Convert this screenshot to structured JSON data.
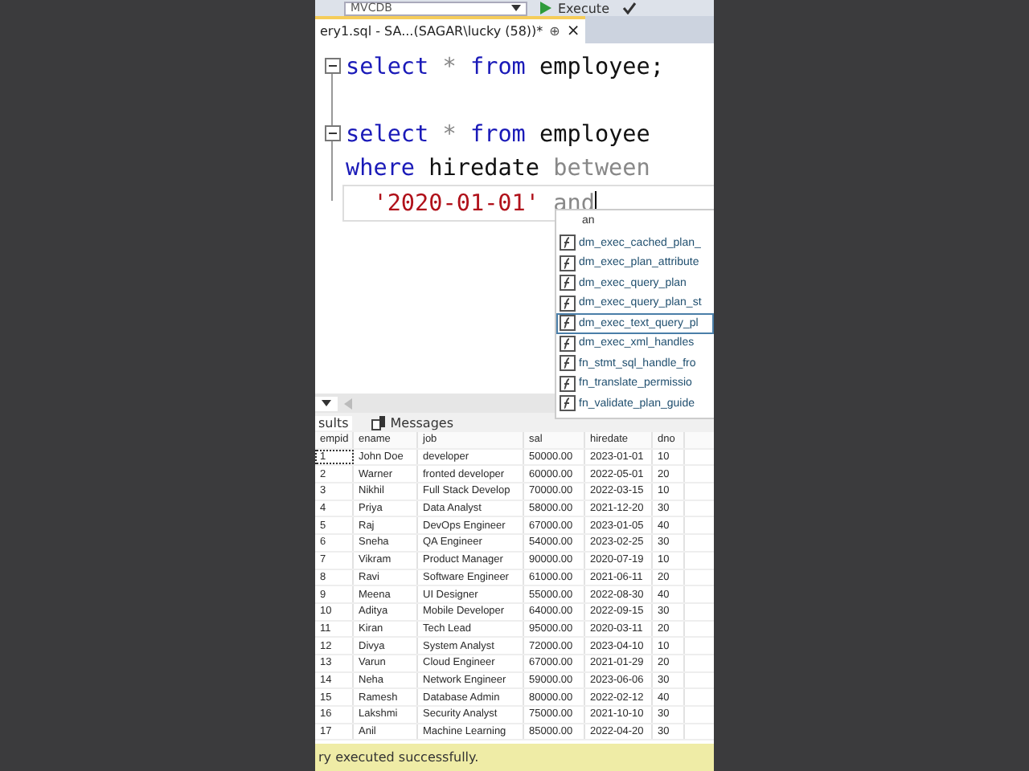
{
  "toolbar": {
    "database": "MVCDB",
    "execute": "Execute"
  },
  "tab": {
    "title": "ery1.sql - SA...(SAGAR\\lucky (58))*",
    "pin": "⊕",
    "close": "×"
  },
  "editor": {
    "lines": [
      {
        "fold": true,
        "current": false,
        "tokens": [
          {
            "text": "select",
            "kind": "keyword"
          },
          {
            "text": " * ",
            "kind": "operator"
          },
          {
            "text": "from",
            "kind": "keyword"
          },
          {
            "text": " employee;",
            "kind": "identifier"
          }
        ]
      },
      {
        "fold": false,
        "current": false
      },
      {
        "fold": true,
        "current": false,
        "tokens": [
          {
            "text": "select",
            "kind": "keyword"
          },
          {
            "text": " * ",
            "kind": "operator"
          },
          {
            "text": "from",
            "kind": "keyword"
          },
          {
            "text": " employee",
            "kind": "identifier"
          }
        ]
      },
      {
        "fold": false,
        "current": false,
        "tokens": [
          {
            "text": "where",
            "kind": "keyword"
          },
          {
            "text": " hiredate ",
            "kind": "identifier"
          },
          {
            "text": "between",
            "kind": "operator"
          }
        ]
      },
      {
        "fold": false,
        "current": true,
        "tokens": [
          {
            "text": "  '2020-01-01'",
            "kind": "string"
          },
          {
            "text": " and",
            "kind": "operator"
          }
        ]
      }
    ]
  },
  "autocomplete": {
    "typed": "an",
    "items": [
      {
        "label": "dm_exec_cached_plan_",
        "selected": false
      },
      {
        "label": "dm_exec_plan_attribute",
        "selected": false
      },
      {
        "label": "dm_exec_query_plan",
        "selected": false
      },
      {
        "label": "dm_exec_query_plan_st",
        "selected": false
      },
      {
        "label": "dm_exec_text_query_pl",
        "selected": true
      },
      {
        "label": "dm_exec_xml_handles",
        "selected": false
      },
      {
        "label": "fn_stmt_sql_handle_fro",
        "selected": false
      },
      {
        "label": "fn_translate_permissio",
        "selected": false
      },
      {
        "label": "fn_validate_plan_guide",
        "selected": false
      }
    ]
  },
  "result_tabs": [
    {
      "label": "sults",
      "selected": true
    },
    {
      "label": "Messages",
      "selected": false
    }
  ],
  "table": {
    "columns": [
      "empid",
      "ename",
      "job",
      "sal",
      "hiredate",
      "dno"
    ],
    "rows": [
      [
        "1",
        "John Doe",
        "developer",
        "50000.00",
        "2023-01-01",
        "10"
      ],
      [
        "2",
        "Warner",
        "fronted developer",
        "60000.00",
        "2022-05-01",
        "20"
      ],
      [
        "3",
        "Nikhil",
        "Full Stack Develop",
        "70000.00",
        "2022-03-15",
        "10"
      ],
      [
        "4",
        "Priya",
        "Data Analyst",
        "58000.00",
        "2021-12-20",
        "30"
      ],
      [
        "5",
        "Raj",
        "DevOps Engineer",
        "67000.00",
        "2023-01-05",
        "40"
      ],
      [
        "6",
        "Sneha",
        "QA Engineer",
        "54000.00",
        "2023-02-25",
        "30"
      ],
      [
        "7",
        "Vikram",
        "Product Manager",
        "90000.00",
        "2020-07-19",
        "10"
      ],
      [
        "8",
        "Ravi",
        "Software Engineer",
        "61000.00",
        "2021-06-11",
        "20"
      ],
      [
        "9",
        "Meena",
        "UI Designer",
        "55000.00",
        "2022-08-30",
        "40"
      ],
      [
        "10",
        "Aditya",
        "Mobile Developer",
        "64000.00",
        "2022-09-15",
        "30"
      ],
      [
        "11",
        "Kiran",
        "Tech Lead",
        "95000.00",
        "2020-03-11",
        "20"
      ],
      [
        "12",
        "Divya",
        "System Analyst",
        "72000.00",
        "2023-04-10",
        "10"
      ],
      [
        "13",
        "Varun",
        "Cloud Engineer",
        "67000.00",
        "2021-01-29",
        "20"
      ],
      [
        "14",
        "Neha",
        "Network Engineer",
        "59000.00",
        "2023-06-06",
        "30"
      ],
      [
        "15",
        "Ramesh",
        "Database Admin",
        "80000.00",
        "2022-02-12",
        "40"
      ],
      [
        "16",
        "Lakshmi",
        "Security Analyst",
        "75000.00",
        "2021-10-10",
        "30"
      ],
      [
        "17",
        "Anil",
        "Machine Learning",
        "85000.00",
        "2022-04-20",
        "30"
      ]
    ]
  },
  "status_bar": "ry executed successfully."
}
